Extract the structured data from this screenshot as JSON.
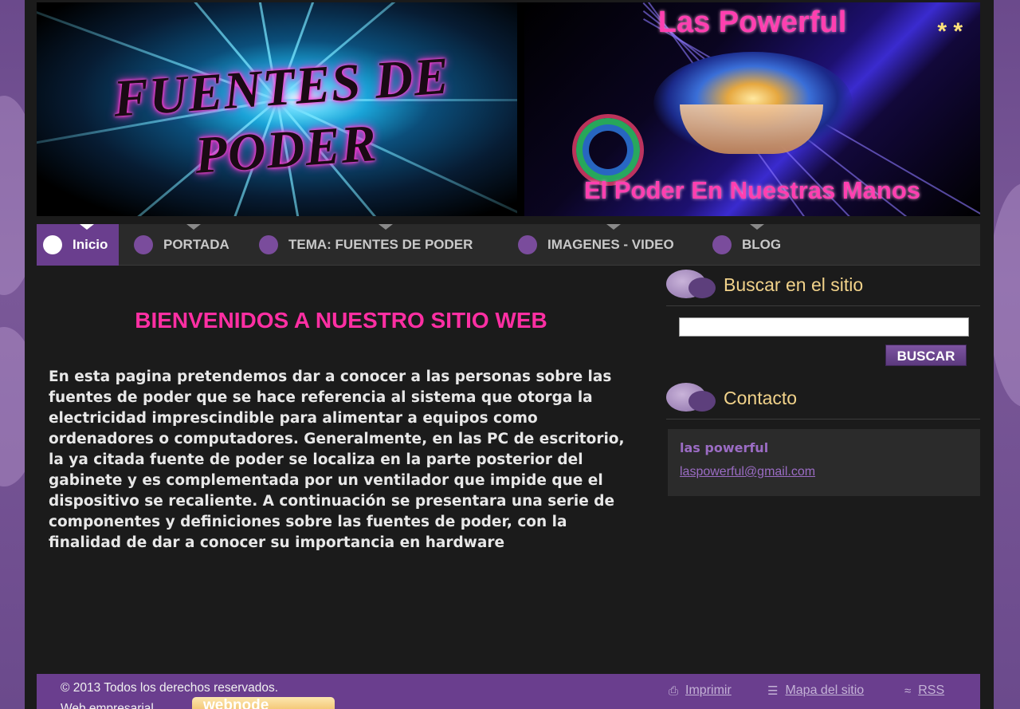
{
  "header": {
    "banner_left_title": "FUENTES DE PODER",
    "brand_name": "Las Powerful",
    "brand_stars": "* *",
    "slogan": "El Poder En Nuestras Manos"
  },
  "nav": {
    "items": [
      {
        "label": "Inicio",
        "active": true
      },
      {
        "label": "PORTADA",
        "active": false
      },
      {
        "label": "TEMA: FUENTES DE PODER",
        "active": false
      },
      {
        "label": "IMAGENES - VIDEO",
        "active": false
      },
      {
        "label": "BLOG",
        "active": false
      }
    ]
  },
  "main": {
    "welcome_title": "BIENVENIDOS A NUESTRO SITIO WEB",
    "intro_text": "En esta pagina pretendemos dar a conocer a las personas sobre las fuentes de poder que se hace referencia al sistema que otorga la electricidad imprescindible para alimentar a equipos como ordenadores o computadores. Generalmente, en las PC de escritorio, la ya citada fuente de poder se localiza en la parte posterior del gabinete y es complementada por un ventilador que impide que el dispositivo se recaliente. A continuación se presentara una serie de componentes y definiciones sobre las fuentes de poder, con la finalidad de dar a conocer su importancia en hardware"
  },
  "sidebar": {
    "search_heading": "Buscar en el sitio",
    "search_value": "",
    "search_button": "BUSCAR",
    "contact_heading": "Contacto",
    "contact_name": "las powerful",
    "contact_email": "laspowerful@gmail.com"
  },
  "footer": {
    "copyright": "© 2013 Todos los derechos reservados.",
    "web_empresarial": "Web empresarial",
    "badge_text": "webnode",
    "print_label": "Imprimir",
    "sitemap_label": "Mapa del sitio",
    "rss_label": "RSS"
  },
  "colors": {
    "accent_purple": "#6a3e8e",
    "title_pink": "#ff2fa3",
    "heading_gold": "#f1d28a",
    "page_bg": "#1b1b1b"
  }
}
